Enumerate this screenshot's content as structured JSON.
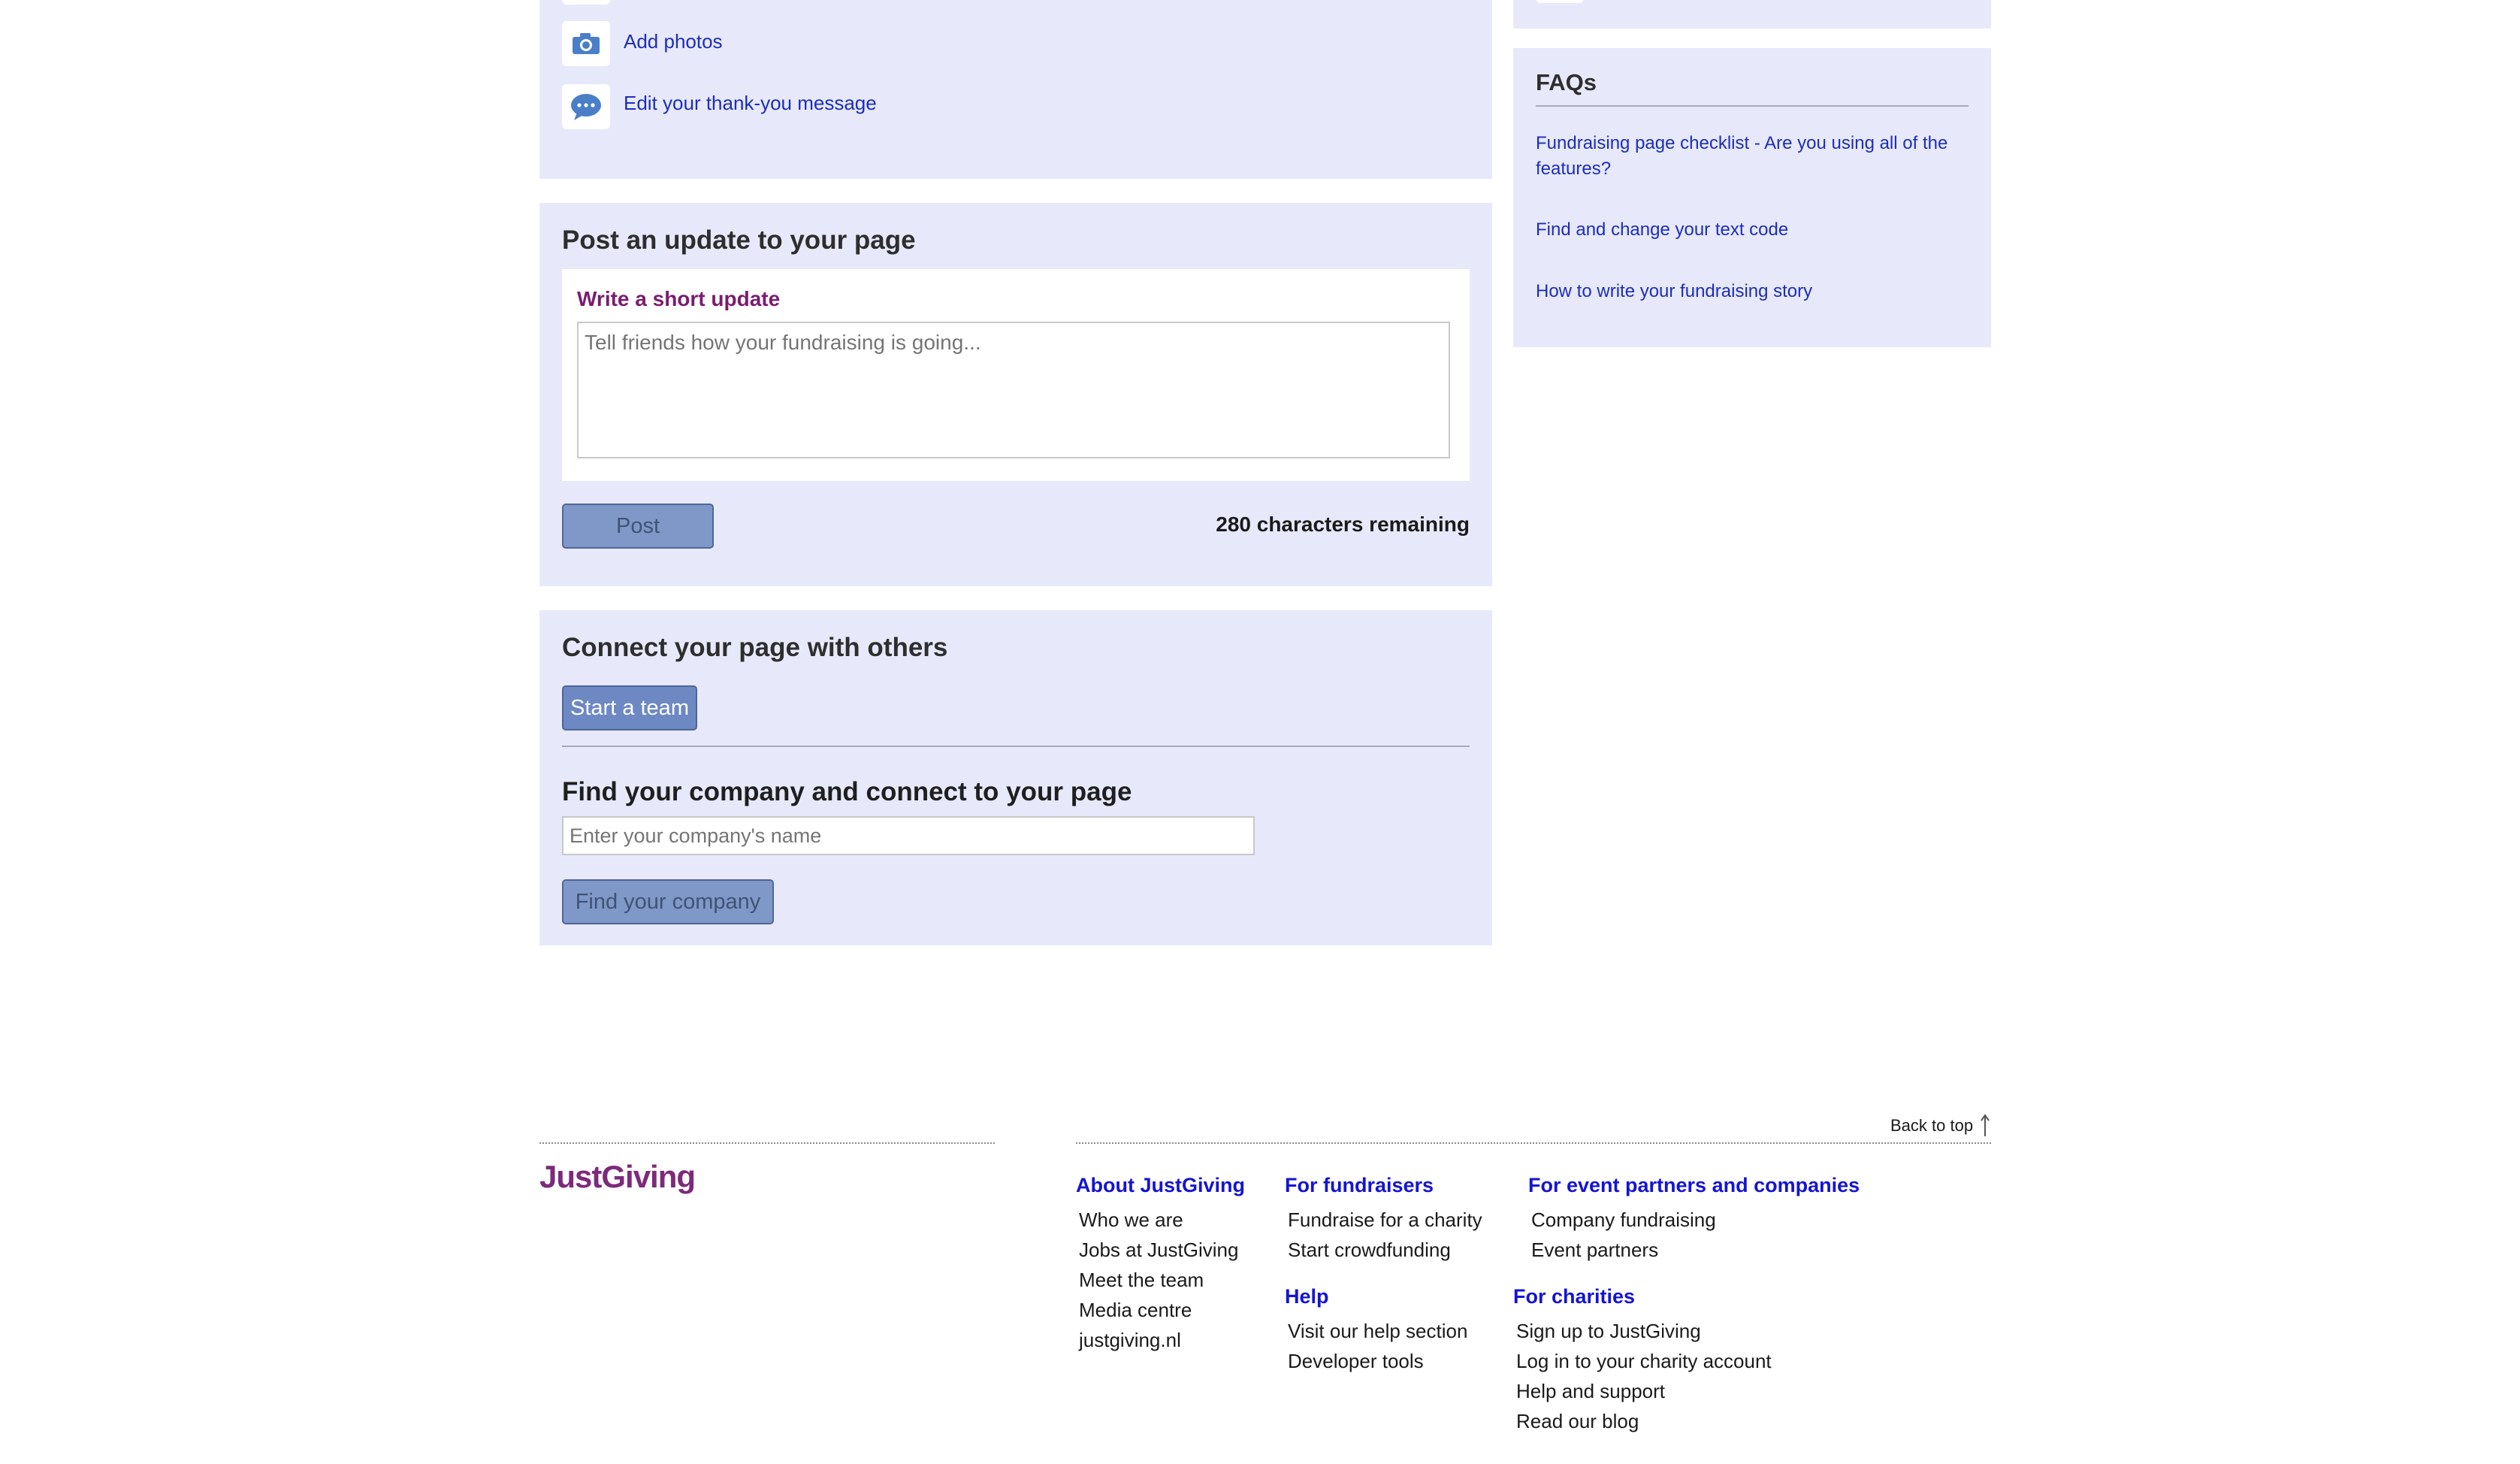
{
  "quick_links": {
    "add_photos": "Add photos",
    "edit_thank_you": "Edit your thank-you message"
  },
  "post_update": {
    "title": "Post an update to your page",
    "label": "Write a short update",
    "placeholder": "Tell friends how your fundraising is going...",
    "post_button": "Post",
    "chars_remaining": "280 characters remaining"
  },
  "connect": {
    "title": "Connect your page with others",
    "start_team_button": "Start a team",
    "company_title": "Find your company and connect to your page",
    "company_placeholder": "Enter your company's name",
    "find_company_button": "Find your company"
  },
  "faqs": {
    "title": "FAQs",
    "items": [
      "Fundraising page checklist - Are you using all of the features?",
      "Find and change your text code",
      "How to write your fundraising story"
    ]
  },
  "footer": {
    "back_to_top": "Back to top",
    "logo": "JustGiving",
    "about": {
      "heading": "About JustGiving",
      "links": [
        "Who we are",
        "Jobs at JustGiving",
        "Meet the team",
        "Media centre",
        "justgiving.nl"
      ]
    },
    "fundraisers": {
      "heading": "For fundraisers",
      "links": [
        "Fundraise for a charity",
        "Start crowdfunding"
      ]
    },
    "help": {
      "heading": "Help",
      "links": [
        "Visit our help section",
        "Developer tools"
      ]
    },
    "event_partners": {
      "heading": "For event partners and companies",
      "links": [
        "Company fundraising",
        "Event partners"
      ]
    },
    "charities": {
      "heading": "For charities",
      "links": [
        "Sign up to JustGiving",
        "Log in to your charity account",
        "Help and support",
        "Read our blog"
      ]
    }
  },
  "colors": {
    "panel": "#e7e9fb",
    "link": "#1d2db8",
    "label_purple": "#7a1d6e",
    "footer_heading": "#1414d4",
    "brand": "#7d2a7b"
  }
}
